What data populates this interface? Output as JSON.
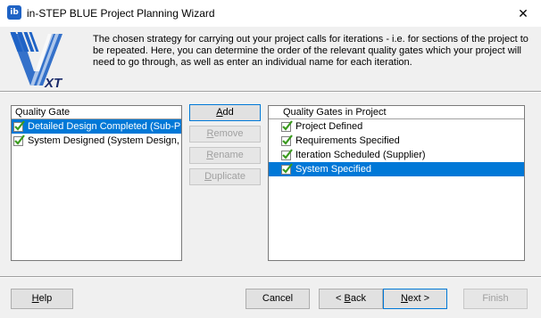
{
  "window": {
    "icon_text": "ib",
    "title": "in-STEP BLUE Project Planning Wizard",
    "close_glyph": "✕"
  },
  "header": {
    "logo_text": "XT",
    "description": "The chosen strategy for carrying out your project calls for iterations - i.e. for sections of the project to be repeated. Here, you can determine the order of the relevant quality gates which your project will need to go through, as well as enter an individual name for each iteration."
  },
  "left_list": {
    "header": "Quality Gate",
    "items": [
      {
        "label": "Detailed Design Completed (Sub-Pr",
        "selected": true,
        "icon": "check-icon"
      },
      {
        "label": "System Designed (System Design, [",
        "selected": false,
        "icon": "check-icon"
      }
    ]
  },
  "side_buttons": {
    "add": {
      "first": "A",
      "rest": "dd"
    },
    "remove": {
      "first": "R",
      "rest": "emove"
    },
    "rename": {
      "first": "R",
      "rest": "ename"
    },
    "duplicate": {
      "first": "D",
      "rest": "uplicate"
    }
  },
  "right_list": {
    "header": "Quality Gates in Project",
    "items": [
      {
        "label": "Project Defined",
        "selected": false,
        "icon": "check-icon"
      },
      {
        "label": "Requirements Specified",
        "selected": false,
        "icon": "check-icon"
      },
      {
        "label": "Iteration Scheduled (Supplier)",
        "selected": false,
        "icon": "check-icon"
      },
      {
        "label": "System Specified",
        "selected": true,
        "icon": "check-icon"
      }
    ]
  },
  "bottom_buttons": {
    "help": {
      "first": "H",
      "rest": "elp"
    },
    "cancel": "Cancel",
    "back": {
      "pre": "< ",
      "first": "B",
      "rest": "ack"
    },
    "next": {
      "first": "N",
      "rest": "ext >"
    },
    "finish": "Finish"
  },
  "colors": {
    "selection": "#0078d7",
    "logo_blue": "#1f63c5",
    "check_green": "#3a9a1e"
  }
}
